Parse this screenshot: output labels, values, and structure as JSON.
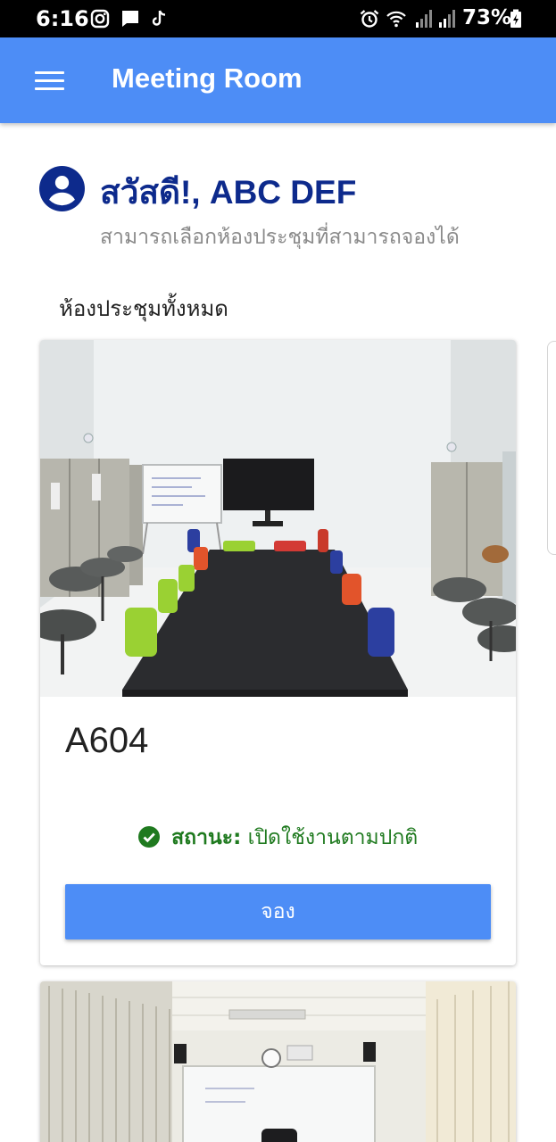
{
  "status_bar": {
    "time": "6:16",
    "battery": "73%",
    "left_icons": [
      "instagram-icon",
      "message-icon",
      "tiktok-icon"
    ],
    "right_icons": [
      "alarm-icon",
      "wifi-icon",
      "signal-icon",
      "signal-icon",
      "battery-charging-icon"
    ]
  },
  "app_bar": {
    "title": "Meeting Room",
    "menu_icon": "menu-icon",
    "color": "#4d8df6"
  },
  "greeting": {
    "title": "สวัสดี!, ABC DEF",
    "subtitle": "สามารถเลือกห้องประชุมที่สามารถจองได้",
    "avatar_icon": "account-circle-icon",
    "title_color": "#0d2a8c"
  },
  "section_title": "ห้องประชุมทั้งหมด",
  "rooms": [
    {
      "name": "A604",
      "status_label": "สถานะ:",
      "status_value": "เปิดใช้งานตามปกติ",
      "status_color": "#1f7a1f",
      "status_icon": "check-circle-icon",
      "book_label": "จอง"
    }
  ]
}
